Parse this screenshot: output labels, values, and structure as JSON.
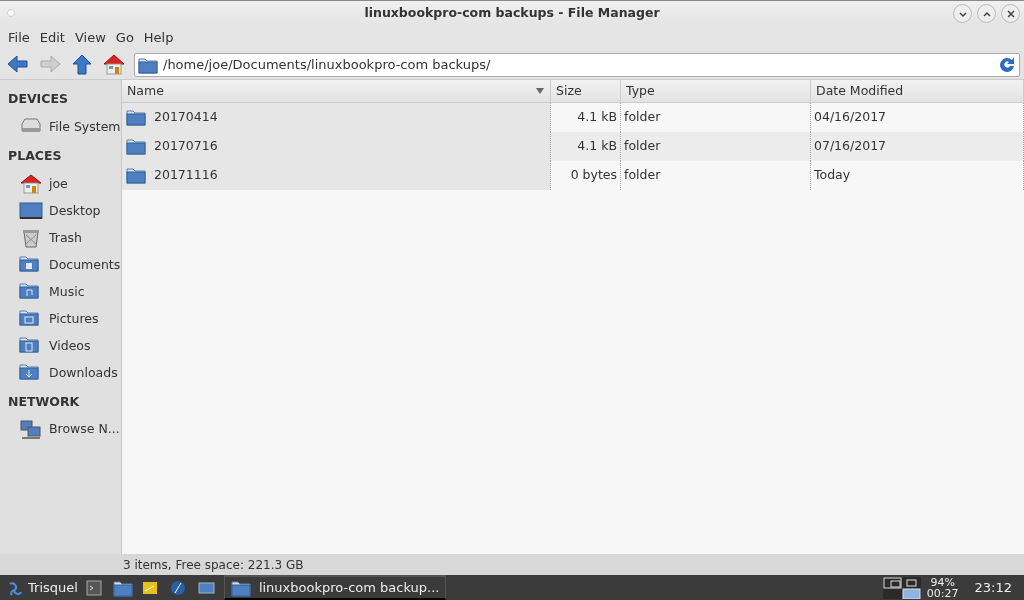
{
  "window": {
    "title": "linuxbookpro-com backups - File Manager"
  },
  "menu": [
    "File",
    "Edit",
    "View",
    "Go",
    "Help"
  ],
  "location": {
    "value": "/home/joe/Documents/linuxbookpro-com backups/"
  },
  "sidebar": [
    {
      "heading": "DEVICES",
      "items": [
        "File System"
      ]
    },
    {
      "heading": "PLACES",
      "items": [
        "joe",
        "Desktop",
        "Trash",
        "Documents",
        "Music",
        "Pictures",
        "Videos",
        "Downloads"
      ]
    },
    {
      "heading": "NETWORK",
      "items": [
        "Browse N..."
      ]
    }
  ],
  "table": {
    "columns": [
      {
        "label": "Name",
        "sorted": true
      },
      {
        "label": "Size",
        "sorted": false
      },
      {
        "label": "Type",
        "sorted": false
      },
      {
        "label": "Date Modified",
        "sorted": false
      }
    ],
    "rows": [
      {
        "name": "20170414",
        "size": "4.1 kB",
        "type": "folder",
        "date": "04/16/2017"
      },
      {
        "name": "20170716",
        "size": "4.1 kB",
        "type": "folder",
        "date": "07/16/2017"
      },
      {
        "name": "20171116",
        "size": "0 bytes",
        "type": "folder",
        "date": "Today"
      }
    ]
  },
  "status_bar": "3 items, Free space: 221.3 GB",
  "taskbar": {
    "menu": "Trisquel",
    "window": "linuxbookpro-com backup...",
    "battery": "94%",
    "battery_time": "00:27",
    "clock": "23:12"
  }
}
